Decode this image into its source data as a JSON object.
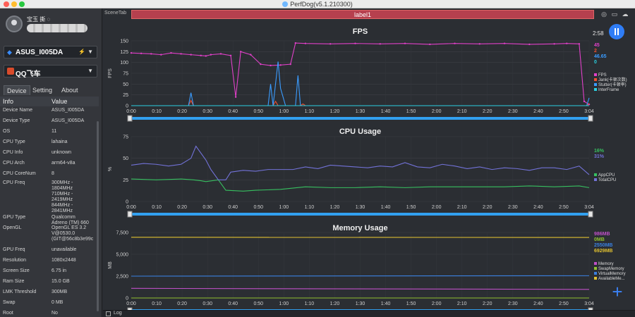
{
  "app": {
    "title": "PerfDog(v5.1.210300)"
  },
  "user": {
    "name": "宝玉 撕 ◌"
  },
  "device": {
    "name": "ASUS_I005DA"
  },
  "target_app": {
    "name": "QQ飞车"
  },
  "tabs": [
    "Device",
    "Setting",
    "About"
  ],
  "info": {
    "headers": [
      "Info",
      "Value"
    ],
    "rows": [
      {
        "k": "Device Name",
        "v": "ASUS_I005DA"
      },
      {
        "k": "Device Type",
        "v": "ASUS_I005DA"
      },
      {
        "k": "OS",
        "v": "11"
      },
      {
        "k": "CPU Type",
        "v": "lahaina"
      },
      {
        "k": "CPU Info",
        "v": "unknown"
      },
      {
        "k": "CPU Arch",
        "v": "arm64-v8a"
      },
      {
        "k": "CPU CoreNum",
        "v": "8"
      },
      {
        "k": "CPU Freq",
        "v": "300MHz -\n1804MHz\n710MHz -\n2419MHz\n844MHz -\n2841MHz"
      },
      {
        "k": "GPU Type",
        "v": "Qualcomm\nAdreno (TM) 660"
      },
      {
        "k": "OpenGL",
        "v": "OpenGL ES 3.2\nV@0530.0\n(GIT@56c8b3e99c"
      },
      {
        "k": "GPU Freq",
        "v": "unavailable"
      },
      {
        "k": "Resolution",
        "v": "1080x2448"
      },
      {
        "k": "Screen Size",
        "v": "6.75 in"
      },
      {
        "k": "Ram Size",
        "v": "15.0 GB"
      },
      {
        "k": "LMK Threshold",
        "v": "300MB"
      },
      {
        "k": "Swap",
        "v": "0 MB"
      },
      {
        "k": "Root",
        "v": "No"
      }
    ]
  },
  "scene_tab": "SceneTab",
  "label": "label1",
  "log": "Log",
  "colors": {
    "fps": "#e040c8",
    "jank": "#f05030",
    "stutter": "#3a9cff",
    "interframe": "#2bd0e0",
    "appcpu": "#37c060",
    "totalcpu": "#7272d8",
    "memory": "#c050c8",
    "swap": "#90c030",
    "virtual": "#3a80e0",
    "available": "#e0c030",
    "scrollbar": "#32a0f0"
  },
  "time_ticks": [
    "0:00",
    "0:10",
    "0:20",
    "0:30",
    "0:40",
    "0:50",
    "1:00",
    "1:10",
    "1:20",
    "1:30",
    "1:40",
    "1:50",
    "2:00",
    "2:10",
    "2:20",
    "2:30",
    "2:40",
    "2:50",
    "3:04"
  ],
  "fps_chart": {
    "title": "FPS",
    "ylabel": "FPS",
    "yticks": [
      "150",
      "125",
      "100",
      "75",
      "50",
      "25",
      "0"
    ],
    "current_time": "2:58",
    "values": [
      "45",
      "2",
      "46.65",
      "0"
    ],
    "legend": [
      "FPS",
      "Jank(卡顿次数)",
      "Stutter(卡顿率)",
      "InterFrame"
    ]
  },
  "cpu_chart": {
    "title": "CPU Usage",
    "ylabel": "%",
    "yticks": [
      "75",
      "50",
      "25",
      "0"
    ],
    "values": [
      "16%",
      "31%"
    ],
    "legend": [
      "AppCPU",
      "TotalCPU"
    ]
  },
  "mem_chart": {
    "title": "Memory Usage",
    "ylabel": "MB",
    "yticks": [
      "7,500",
      "5,000",
      "2,500",
      "0"
    ],
    "values": [
      "986MB",
      "0MB",
      "2550MB",
      "6929MB"
    ],
    "legend": [
      "Memory",
      "SwapMemory",
      "VirtualMemory",
      "AvailableMe..."
    ]
  },
  "chart_data": [
    {
      "type": "line",
      "title": "FPS",
      "ylabel": "FPS",
      "ylim": [
        0,
        150
      ],
      "xlim": [
        0,
        184
      ],
      "series": [
        {
          "name": "FPS",
          "x": [
            0,
            4,
            8,
            12,
            16,
            20,
            24,
            28,
            30,
            32,
            36,
            40,
            42,
            44,
            48,
            52,
            56,
            60,
            64,
            66,
            70,
            80,
            90,
            100,
            110,
            120,
            130,
            140,
            150,
            160,
            170,
            175,
            180,
            182,
            184
          ],
          "y": [
            122,
            121,
            120,
            118,
            122,
            120,
            118,
            116,
            115,
            118,
            120,
            116,
            20,
            125,
            118,
            96,
            93,
            94,
            96,
            145,
            144,
            143,
            144,
            143,
            144,
            142,
            144,
            143,
            144,
            142,
            143,
            144,
            143,
            10,
            3
          ]
        },
        {
          "name": "Jank(卡顿次数)",
          "x": [
            0,
            23,
            24,
            25,
            57,
            58,
            59,
            68,
            69,
            70,
            183,
            184
          ],
          "y": [
            0,
            0,
            12,
            0,
            0,
            10,
            0,
            0,
            4,
            0,
            0,
            5
          ]
        },
        {
          "name": "Stutter(卡顿率)",
          "x": [
            0,
            23,
            24,
            25,
            55,
            56,
            57,
            59,
            60,
            62,
            66,
            67,
            68,
            183,
            184
          ],
          "y": [
            0,
            0,
            30,
            0,
            0,
            50,
            0,
            102,
            40,
            0,
            0,
            70,
            0,
            0,
            18
          ]
        },
        {
          "name": "InterFrame",
          "x": [
            0,
            184
          ],
          "y": [
            0,
            0
          ]
        }
      ]
    },
    {
      "type": "line",
      "title": "CPU Usage",
      "ylabel": "%",
      "ylim": [
        0,
        75
      ],
      "xlim": [
        0,
        184
      ],
      "series": [
        {
          "name": "AppCPU",
          "x": [
            0,
            10,
            20,
            25,
            28,
            30,
            35,
            38,
            45,
            50,
            60,
            70,
            80,
            90,
            100,
            110,
            120,
            130,
            140,
            150,
            160,
            170,
            180,
            184
          ],
          "y": [
            26,
            25,
            26,
            25,
            24,
            23,
            25,
            13,
            12,
            13,
            14,
            17,
            16,
            16,
            17,
            16,
            17,
            17,
            17,
            17,
            18,
            17,
            18,
            16
          ]
        },
        {
          "name": "TotalCPU",
          "x": [
            0,
            5,
            10,
            15,
            20,
            24,
            26,
            30,
            32,
            35,
            38,
            40,
            45,
            50,
            55,
            60,
            65,
            70,
            75,
            80,
            85,
            90,
            95,
            100,
            105,
            110,
            115,
            120,
            125,
            130,
            135,
            140,
            145,
            150,
            155,
            160,
            165,
            170,
            175,
            180,
            184
          ],
          "y": [
            42,
            44,
            43,
            41,
            43,
            50,
            64,
            48,
            37,
            25,
            25,
            34,
            36,
            35,
            37,
            37,
            37,
            40,
            38,
            42,
            41,
            40,
            39,
            41,
            40,
            45,
            40,
            39,
            43,
            41,
            38,
            40,
            37,
            39,
            38,
            36,
            39,
            39,
            37,
            41,
            31
          ]
        }
      ]
    },
    {
      "type": "line",
      "title": "Memory Usage",
      "ylabel": "MB",
      "ylim": [
        0,
        7500
      ],
      "xlim": [
        0,
        184
      ],
      "series": [
        {
          "name": "Memory",
          "x": [
            0,
            184
          ],
          "y": [
            1100,
            986
          ]
        },
        {
          "name": "SwapMemory",
          "x": [
            0,
            184
          ],
          "y": [
            0,
            0
          ]
        },
        {
          "name": "VirtualMemory",
          "x": [
            0,
            184
          ],
          "y": [
            2500,
            2550
          ]
        },
        {
          "name": "AvailableMe...",
          "x": [
            0,
            184
          ],
          "y": [
            6950,
            6929
          ]
        }
      ]
    }
  ]
}
